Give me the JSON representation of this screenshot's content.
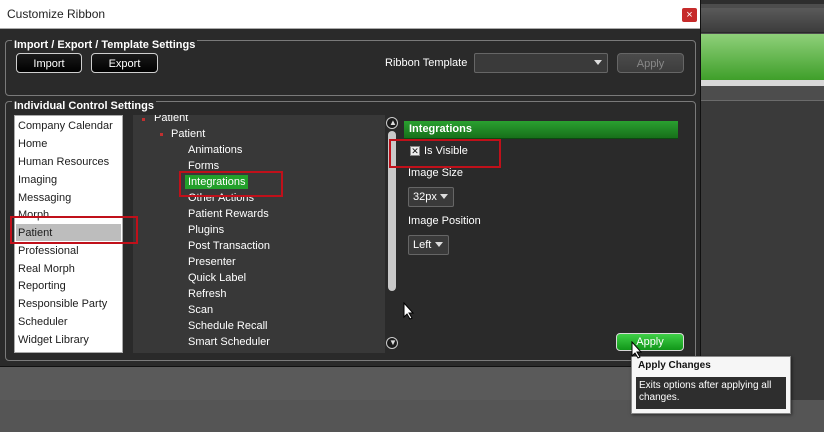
{
  "window": {
    "title": "Customize Ribbon",
    "close": "×"
  },
  "import_export": {
    "group_title": "Import / Export / Template Settings",
    "import_label": "Import",
    "export_label": "Export",
    "ribbon_template_label": "Ribbon Template",
    "ribbon_template_value": "",
    "apply_label": "Apply"
  },
  "individual": {
    "group_title": "Individual Control Settings",
    "categories": [
      "Company Calendar",
      "Home",
      "Human Resources",
      "Imaging",
      "Messaging",
      "Morph",
      "Patient",
      "Professional",
      "Real Morph",
      "Reporting",
      "Responsible Party",
      "Scheduler",
      "Widget Library"
    ],
    "selected_category": "Patient",
    "tree": {
      "root": "Patient",
      "group": "Patient",
      "items": [
        "Animations",
        "Forms",
        "Integrations",
        "Other Actions",
        "Patient Rewards",
        "Plugins",
        "Post Transaction",
        "Presenter",
        "Quick Label",
        "Refresh",
        "Scan",
        "Schedule Recall",
        "Smart Scheduler"
      ],
      "selected": "Integrations"
    },
    "properties": {
      "header": "Integrations",
      "is_visible_label": "Is Visible",
      "is_visible_checked": true,
      "image_size_label": "Image Size",
      "image_size_value": "32px",
      "image_position_label": "Image Position",
      "image_position_value": "Left"
    },
    "apply_label": "Apply"
  },
  "tooltip": {
    "title": "Apply Changes",
    "body": "Exits options after applying all changes."
  },
  "colors": {
    "accent_green": "#22a02a",
    "highlight_red": "#c0101a",
    "close_red": "#c62b2b"
  }
}
